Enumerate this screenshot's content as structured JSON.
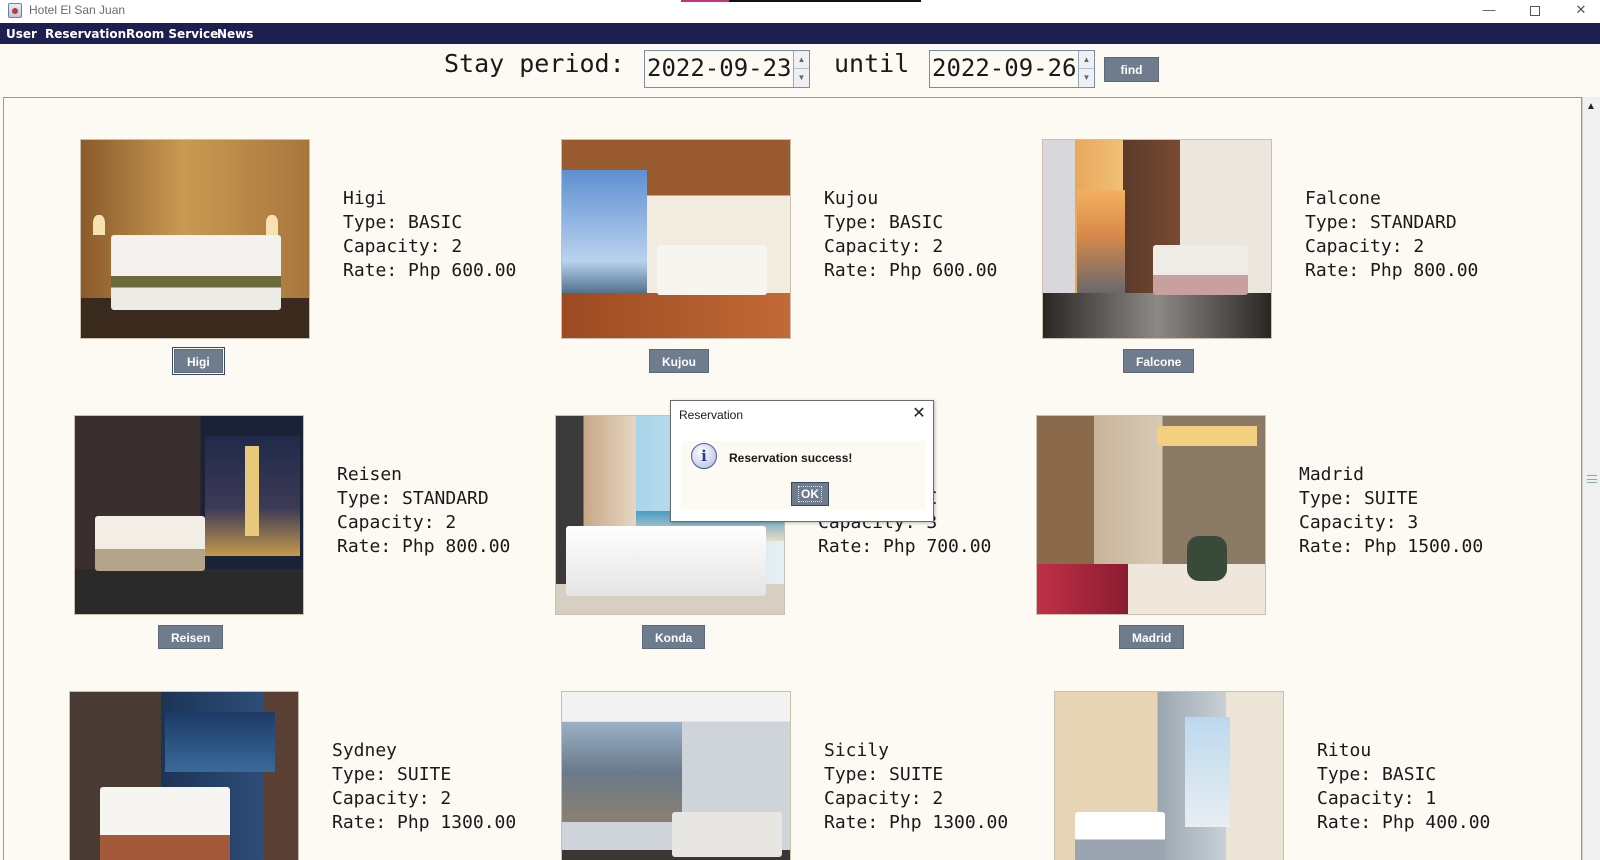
{
  "window": {
    "title": "Hotel El San Juan",
    "minimize_glyph": "—",
    "close_glyph": "✕"
  },
  "menubar": {
    "items": [
      "User",
      "Reservation",
      "Room Service",
      "News"
    ]
  },
  "search": {
    "period_label": "Stay period:",
    "start_date": "2022-09-23",
    "until_label": "until",
    "end_date": "2022-09-26",
    "find_label": "find",
    "spin_up_glyph": "▲",
    "spin_down_glyph": "▼"
  },
  "rooms": [
    {
      "name": "Higi",
      "type": "Type: BASIC",
      "capacity": "Capacity: 2",
      "rate": "Rate: Php 600.00",
      "button": "Higi"
    },
    {
      "name": "Kujou",
      "type": "Type: BASIC",
      "capacity": "Capacity: 2",
      "rate": "Rate: Php 600.00",
      "button": "Kujou"
    },
    {
      "name": "Falcone",
      "type": "Type: STANDARD",
      "capacity": "Capacity: 2",
      "rate": "Rate: Php 800.00",
      "button": "Falcone"
    },
    {
      "name": "Reisen",
      "type": "Type: STANDARD",
      "capacity": "Capacity: 2",
      "rate": "Rate: Php 800.00",
      "button": "Reisen"
    },
    {
      "name": "Konda",
      "type": "Type: BASIC",
      "capacity": "Capacity: 3",
      "rate": "Rate: Php 700.00",
      "button": "Konda"
    },
    {
      "name": "Madrid",
      "type": "Type: SUITE",
      "capacity": "Capacity: 3",
      "rate": "Rate: Php 1500.00",
      "button": "Madrid"
    },
    {
      "name": "Sydney",
      "type": "Type: SUITE",
      "capacity": "Capacity: 2",
      "rate": "Rate: Php 1300.00",
      "button": "Sydney"
    },
    {
      "name": "Sicily",
      "type": "Type: SUITE",
      "capacity": "Capacity: 2",
      "rate": "Rate: Php 1300.00",
      "button": "Sicily"
    },
    {
      "name": "Ritou",
      "type": "Type: BASIC",
      "capacity": "Capacity: 1",
      "rate": "Rate: Php 400.00",
      "button": "Ritou"
    }
  ],
  "dialog": {
    "title": "Reservation",
    "message": "Reservation success!",
    "ok_label": "OK",
    "icon_glyph": "i",
    "close_glyph": "✕"
  },
  "scrollbar": {
    "up_glyph": "▲"
  }
}
